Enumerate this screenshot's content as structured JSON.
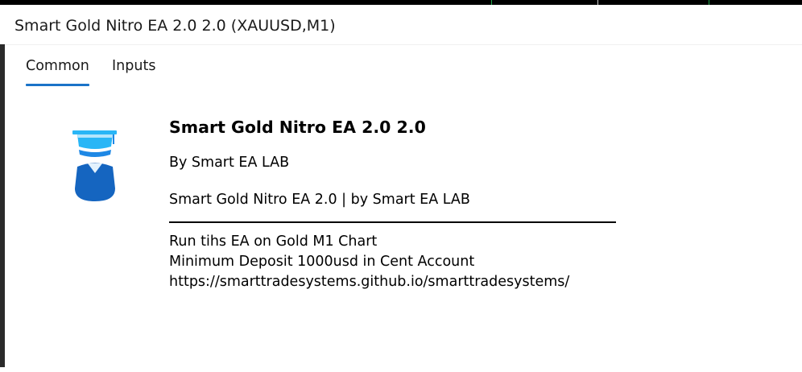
{
  "window": {
    "title": "Smart Gold Nitro EA 2.0 2.0 (XAUUSD,M1)"
  },
  "tabs": [
    {
      "label": "Common",
      "active": true
    },
    {
      "label": "Inputs",
      "active": false
    }
  ],
  "icon": {
    "name": "expert-advisor-icon"
  },
  "expert": {
    "name": "Smart Gold Nitro EA 2.0 2.0",
    "author": "By Smart EA LAB",
    "description": "Smart Gold Nitro EA 2.0 | by Smart EA LAB",
    "notes": [
      "Run tihs EA on Gold M1 Chart",
      "Minimum Deposit 1000usd in Cent Account",
      "https://smarttradesystems.github.io/smarttradesystems/"
    ]
  },
  "colors": {
    "accent": "#1a73c8",
    "icon_dark": "#1565c0",
    "icon_light": "#29b6f6"
  }
}
